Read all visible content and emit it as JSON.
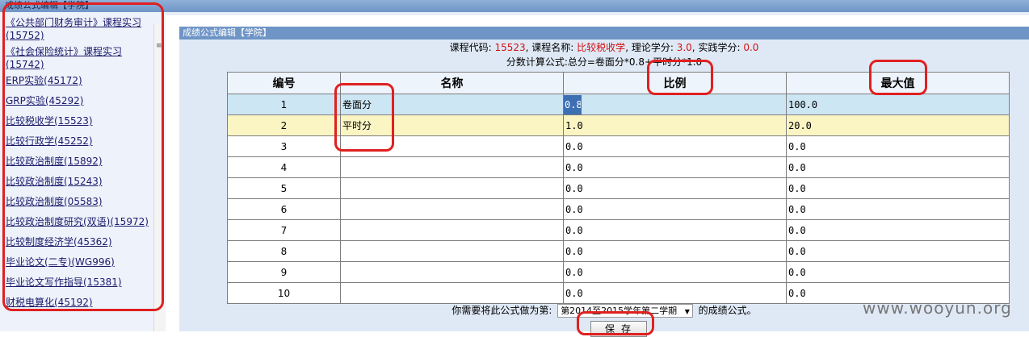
{
  "topbar": {
    "title": "成绩公式编辑【学院】"
  },
  "sidebar": {
    "items": [
      "《公共部门财务审计》课程实习(15752)",
      "《社会保险统计》课程实习(15742)",
      "ERP实验(45172)",
      "GRP实验(45292)",
      "比较税收学(15523)",
      "比较行政学(45252)",
      "比较政治制度(15892)",
      "比较政治制度(15243)",
      "比较政治制度(05583)",
      "比较政治制度研究(双语)(15972)",
      "比较制度经济学(45362)",
      "毕业论文(二专)(WG996)",
      "毕业论文写作指导(15381)",
      "财税电算化(45192)"
    ]
  },
  "main": {
    "title": "成绩公式编辑【学院】",
    "course_code_label": "课程代码:",
    "course_code": "15523",
    "course_name_label": "课程名称:",
    "course_name": "比较税收学",
    "theory_credit_label": "理论学分:",
    "theory_credit": "3.0",
    "practice_credit_label": "实践学分:",
    "practice_credit": "0.0",
    "formula": "分数计算公式:总分=卷面分*0.8+平时分*1.0",
    "table": {
      "headers": {
        "num": "编号",
        "name": "名称",
        "ratio": "比例",
        "max": "最大值"
      },
      "rows": [
        {
          "num": "1",
          "name": "卷面分",
          "ratio": "0.8",
          "max": "100.0"
        },
        {
          "num": "2",
          "name": "平时分",
          "ratio": "1.0",
          "max": "20.0"
        },
        {
          "num": "3",
          "name": "",
          "ratio": "0.0",
          "max": "0.0"
        },
        {
          "num": "4",
          "name": "",
          "ratio": "0.0",
          "max": "0.0"
        },
        {
          "num": "5",
          "name": "",
          "ratio": "0.0",
          "max": "0.0"
        },
        {
          "num": "6",
          "name": "",
          "ratio": "0.0",
          "max": "0.0"
        },
        {
          "num": "7",
          "name": "",
          "ratio": "0.0",
          "max": "0.0"
        },
        {
          "num": "8",
          "name": "",
          "ratio": "0.0",
          "max": "0.0"
        },
        {
          "num": "9",
          "name": "",
          "ratio": "0.0",
          "max": "0.0"
        },
        {
          "num": "10",
          "name": "",
          "ratio": "0.0",
          "max": "0.0"
        }
      ]
    },
    "bottom_prefix": "你需要将此公式做为第:",
    "term_selected": "第2014至2015学年第二学期",
    "bottom_suffix": "的成绩公式。",
    "save_label": "保存"
  },
  "watermark": "www.wooyun.org",
  "colors": {
    "annotation": "#e02020",
    "highlight": "#d01010",
    "header_bar": "#6f95c6"
  }
}
